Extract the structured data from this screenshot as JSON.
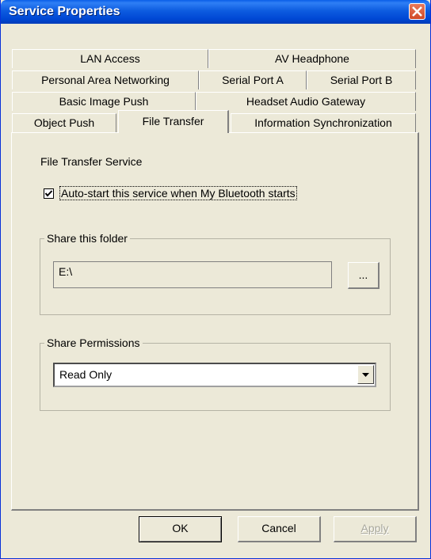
{
  "window": {
    "title": "Service Properties"
  },
  "tabs": {
    "row1": [
      "LAN Access",
      "AV Headphone"
    ],
    "row2": [
      "Personal Area Networking",
      "Serial Port A",
      "Serial Port B"
    ],
    "row3": [
      "Basic Image Push",
      "Headset Audio Gateway"
    ],
    "row4": [
      "Object Push",
      "File Transfer",
      "Information Synchronization"
    ],
    "active": "File Transfer"
  },
  "panel": {
    "heading": "File Transfer Service",
    "autostart": {
      "checked": true,
      "label": "Auto-start this service when My Bluetooth starts"
    },
    "share_folder": {
      "title": "Share this folder",
      "value": "E:\\",
      "browse_label": "..."
    },
    "permissions": {
      "title": "Share Permissions",
      "selected": "Read Only"
    }
  },
  "buttons": {
    "ok": "OK",
    "cancel": "Cancel",
    "apply": "Apply"
  }
}
